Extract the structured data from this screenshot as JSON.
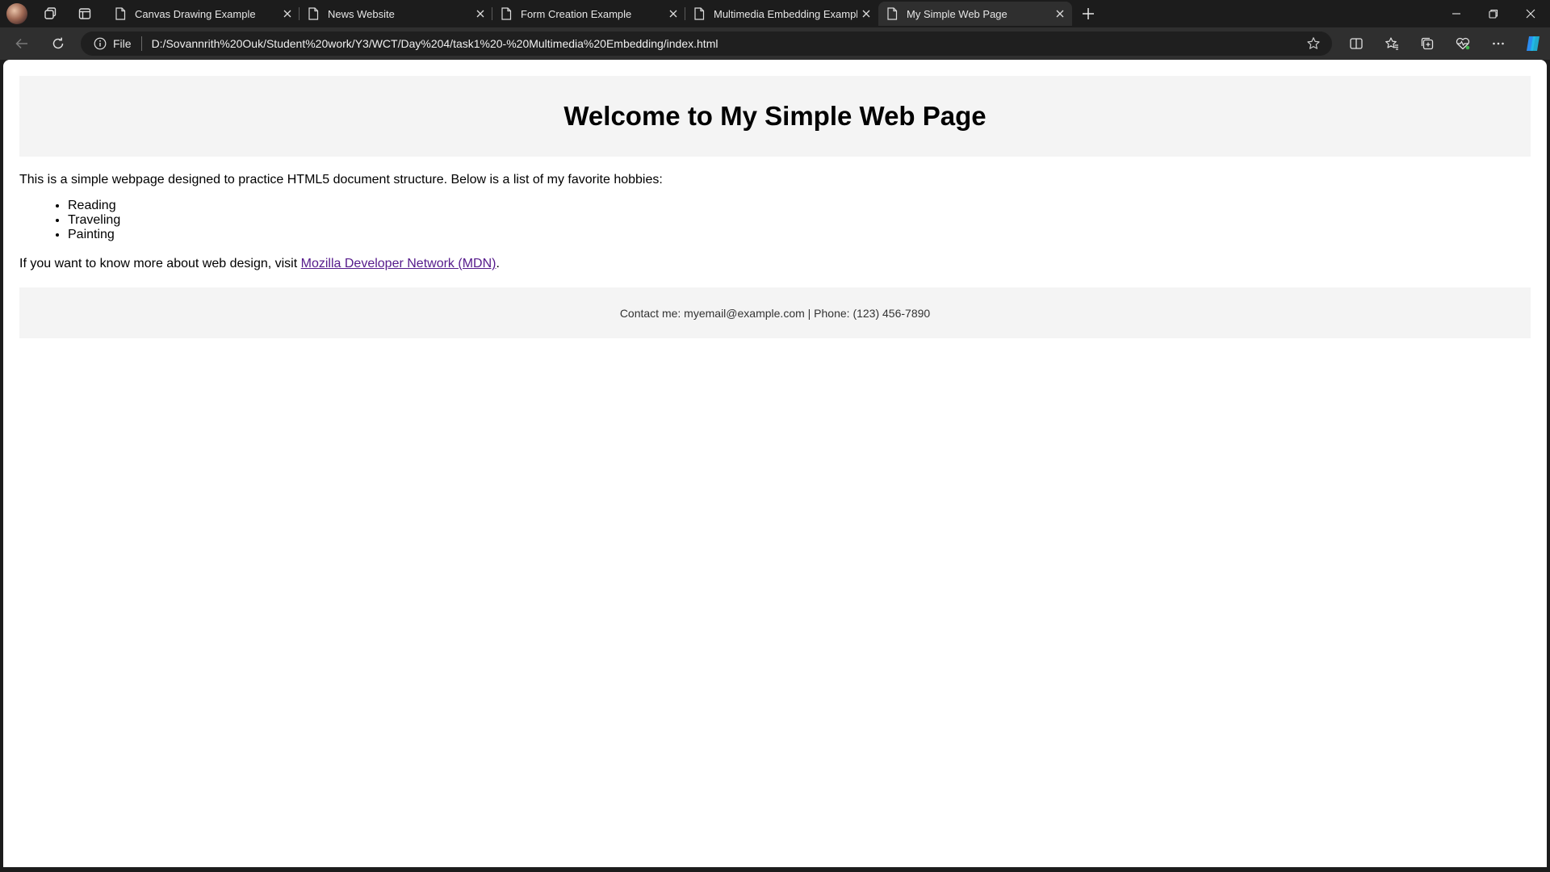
{
  "browser": {
    "tabs": [
      {
        "title": "Canvas Drawing Example",
        "active": false
      },
      {
        "title": "News Website",
        "active": false
      },
      {
        "title": "Form Creation Example",
        "active": false
      },
      {
        "title": "Multimedia Embedding Example",
        "active": false
      },
      {
        "title": "My Simple Web Page",
        "active": true
      }
    ],
    "address_bar": {
      "site_info_label": "File",
      "url": "D:/Sovannrith%20Ouk/Student%20work/Y3/WCT/Day%204/task1%20-%20Multimedia%20Embedding/index.html"
    },
    "colors": {
      "chrome_dark": "#1c1c1c",
      "toolbar": "#2f2f2f",
      "copilot_blue": "#2b8cf0"
    }
  },
  "page": {
    "header": {
      "title": "Welcome to My Simple Web Page"
    },
    "intro": "This is a simple webpage designed to practice HTML5 document structure. Below is a list of my favorite hobbies:",
    "hobbies": [
      "Reading",
      "Traveling",
      "Painting"
    ],
    "more_info": {
      "prefix": "If you want to know more about web design, visit ",
      "link_text": "Mozilla Developer Network (MDN)",
      "suffix": "."
    },
    "footer": {
      "contact": "Contact me: myemail@example.com | Phone: (123) 456-7890"
    },
    "colors": {
      "section_bg": "#f4f4f4",
      "visited_link": "#551a8b"
    }
  }
}
